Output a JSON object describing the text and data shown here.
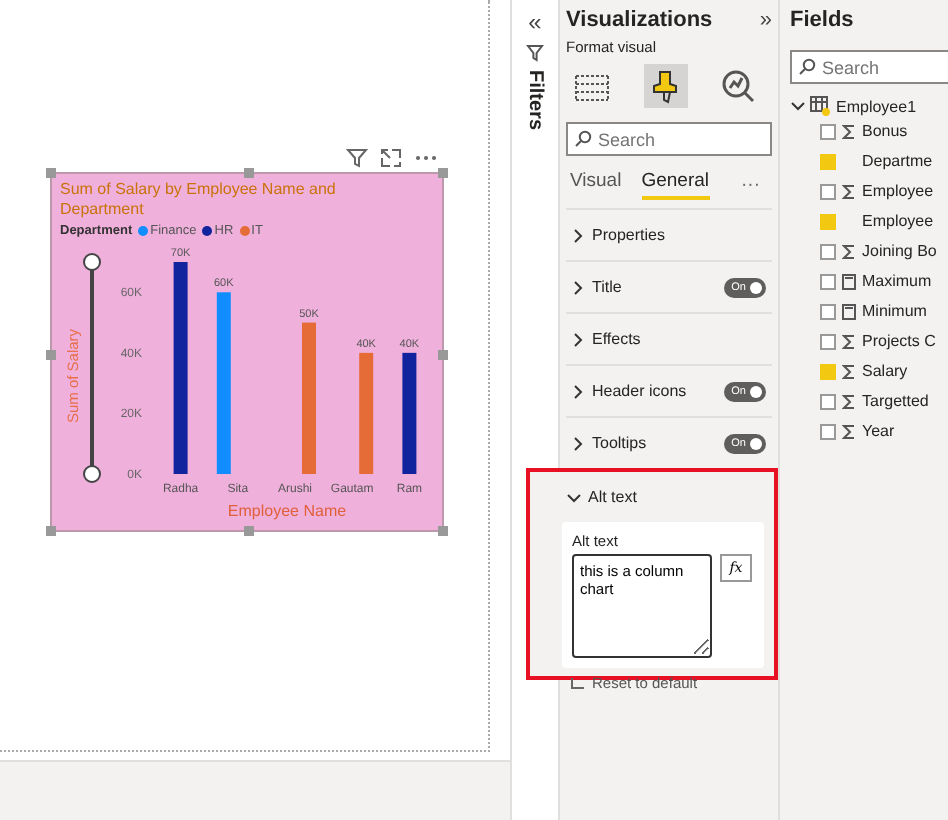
{
  "canvas": {
    "visual": {
      "title": "Sum of Salary by Employee Name and Department",
      "legend": {
        "title": "Department"
      },
      "chart_data": {
        "type": "bar",
        "xlabel": "Employee Name",
        "ylabel": "Sum of Salary",
        "categories": [
          "Radha",
          "Sita",
          "Arushi",
          "Gautam",
          "Ram"
        ],
        "series": [
          {
            "name": "Finance",
            "color": "#118dff",
            "values": [
              null,
              60000,
              null,
              null,
              null
            ]
          },
          {
            "name": "HR",
            "color": "#12239e",
            "values": [
              70000,
              null,
              null,
              null,
              40000
            ]
          },
          {
            "name": "IT",
            "color": "#e66c37",
            "values": [
              null,
              null,
              50000,
              40000,
              null
            ]
          }
        ],
        "ylim": [
          0,
          70000
        ],
        "yticks": [
          {
            "value": 0,
            "label": "0K"
          },
          {
            "value": 20000,
            "label": "20K"
          },
          {
            "value": 40000,
            "label": "40K"
          },
          {
            "value": 60000,
            "label": "60K"
          }
        ],
        "value_labels": [
          "70K",
          "60K",
          "50K",
          "40K",
          "40K"
        ]
      }
    }
  },
  "filters": {
    "collapse": "«",
    "title": "Filters"
  },
  "visualizations": {
    "title": "Visualizations",
    "expand": "»",
    "subtitle": "Format visual",
    "modes": [
      {
        "kind": "build",
        "selected": false
      },
      {
        "kind": "format",
        "selected": true
      },
      {
        "kind": "analytics",
        "selected": false
      }
    ],
    "search": {
      "placeholder": "Search"
    },
    "tabs": [
      {
        "label": "Visual",
        "selected": false
      },
      {
        "label": "General",
        "selected": true
      }
    ],
    "more": "···",
    "sections": [
      {
        "label": "Properties",
        "expanded": false
      },
      {
        "label": "Title",
        "expanded": false,
        "toggle": {
          "label": "On",
          "on": true
        }
      },
      {
        "label": "Effects",
        "expanded": false
      },
      {
        "label": "Header icons",
        "expanded": false,
        "toggle": {
          "label": "On",
          "on": true
        }
      },
      {
        "label": "Tooltips",
        "expanded": false,
        "toggle": {
          "label": "On",
          "on": true
        }
      },
      {
        "label": "Alt text",
        "expanded": true,
        "highlighted": true,
        "field_label": "Alt text",
        "value": "this is a column chart",
        "fx": "fx"
      }
    ],
    "reset": "Reset to default"
  },
  "fields": {
    "title": "Fields",
    "search": {
      "placeholder": "Search"
    },
    "tables": [
      {
        "name": "Employee1",
        "expanded": true,
        "children": [
          {
            "name": "Bonus",
            "kind": "sum",
            "checked": false
          },
          {
            "name": "Departme",
            "kind": "text",
            "checked": true
          },
          {
            "name": "Employee",
            "kind": "sum",
            "checked": false
          },
          {
            "name": "Employee",
            "kind": "text",
            "checked": true
          },
          {
            "name": "Joining Bo",
            "kind": "sum",
            "checked": false
          },
          {
            "name": "Maximum",
            "kind": "calc",
            "checked": false
          },
          {
            "name": "Minimum",
            "kind": "calc",
            "checked": false
          },
          {
            "name": "Projects C",
            "kind": "sum",
            "checked": false
          },
          {
            "name": "Salary",
            "kind": "sum",
            "checked": true
          },
          {
            "name": "Targetted",
            "kind": "sum",
            "checked": false
          },
          {
            "name": "Year",
            "kind": "sum",
            "checked": false
          }
        ]
      }
    ]
  }
}
